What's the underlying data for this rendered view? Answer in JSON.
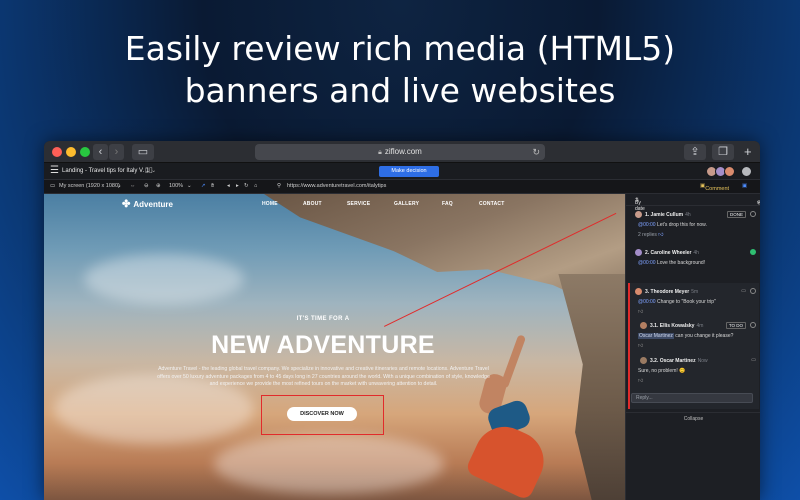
{
  "headline": {
    "line1": "Easily review rich media (HTML5)",
    "line2": "banners and live websites"
  },
  "browser": {
    "url": "ziflow.com"
  },
  "app": {
    "proof_title": "Landing - Travel tips for Italy",
    "version": "V. 1",
    "make_decision_label": "Make decision"
  },
  "viewbar": {
    "device": "My screen (1920 x 1080)",
    "zoom": "100%",
    "site_url": "https://www.adventuretravel.com/italytips",
    "comment_label": "Comment"
  },
  "website": {
    "logo": "Adventure",
    "nav": [
      "HOME",
      "ABOUT",
      "SERVICE",
      "GALLERY",
      "FAQ",
      "CONTACT"
    ],
    "eyebrow": "IT'S TIME FOR A",
    "title": "NEW ADVENTURE",
    "body": "Adventure Travel - the leading global travel company. We specialize in innovative and creative itineraries and remote locations. Adventure Travel offers over 50 luxury adventure packages from 4 to 45 days long in 27 countries around the world. With a unique combination of style, knowledge and experience we provide the most refined tours on the market with unwavering attention to detail.",
    "cta": "DISCOVER NOW"
  },
  "panel": {
    "sort_label": "By date",
    "comments": [
      {
        "name": "1. Jamie Cullum",
        "time": "4h",
        "status": "DONE",
        "timecode": "@00:00",
        "text": "Let's drop this for now.",
        "meta": "2 replies",
        "avatar_color": "#c79a8a"
      },
      {
        "name": "2. Caroline Wheeler",
        "time": "4h",
        "timecode": "@00:00",
        "text": "Love the background!",
        "avatar_color": "#a48ec9"
      },
      {
        "name": "3. Theodore Meyer",
        "time": "5m",
        "timecode": "@00:00",
        "text": "Change to \"Book your trip\"",
        "avatar_color": "#d98b6d"
      },
      {
        "name": "3.1. Ellis Kowalsky",
        "time": "4m",
        "status": "TO DO",
        "mention": "Oscar Martinez",
        "text": "can you change it please?",
        "avatar_color": "#b37f62"
      },
      {
        "name": "3.2. Oscar Martinez",
        "time": "Now",
        "text": "Sure, no problem! 😊",
        "avatar_color": "#9b7b63"
      }
    ],
    "reply_placeholder": "Reply...",
    "collapse_label": "Collapse"
  },
  "colors": {
    "accent": "#2e6ee6",
    "annotation": "#e12b2b",
    "done": "#2fbf71"
  }
}
